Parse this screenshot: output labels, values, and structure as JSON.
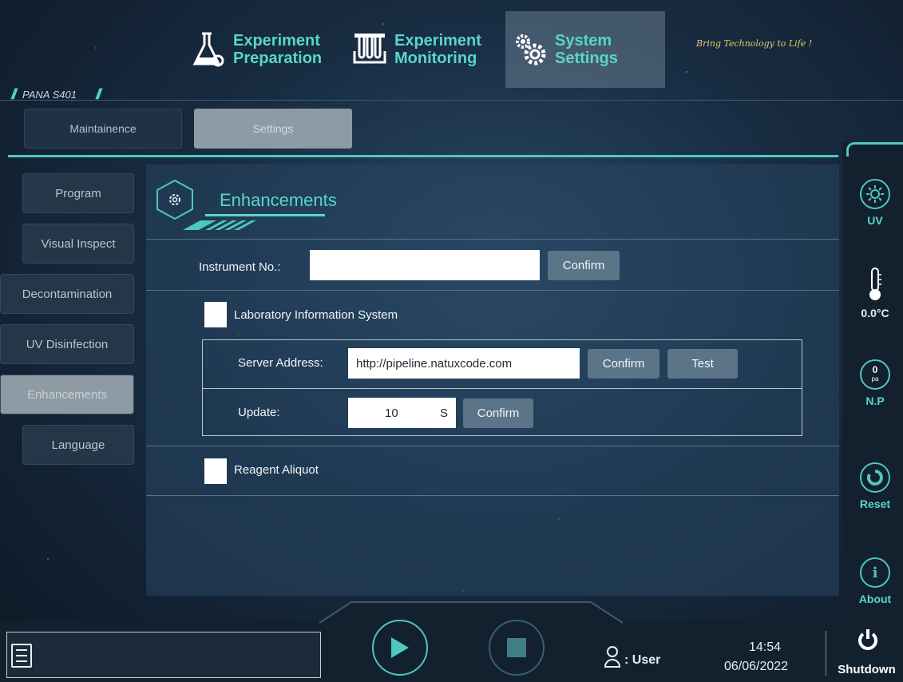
{
  "brand": {
    "model": "PANA S401",
    "tagline": "Bring Technology to Life !"
  },
  "nav": {
    "tabs": [
      {
        "line1": "Experiment",
        "line2": "Preparation",
        "icon": "flask-gear-icon"
      },
      {
        "line1": "Experiment",
        "line2": "Monitoring",
        "icon": "test-tube-rack-icon"
      },
      {
        "line1": "System",
        "line2": "Settings",
        "icon": "gears-icon",
        "active": true
      }
    ]
  },
  "subtabs": {
    "maintenance": "Maintainence",
    "settings": "Settings"
  },
  "left_menu": [
    "Program",
    "Visual Inspect",
    "Decontamination",
    "UV Disinfection",
    "Enhancements",
    "Language"
  ],
  "panel": {
    "title": "Enhancements",
    "instrument": {
      "label": "Instrument No.:",
      "value": "",
      "confirm": "Confirm"
    },
    "lis": {
      "label": "Laboratory Information System",
      "checked": false,
      "server_label": "Server Address:",
      "server_value": "http://pipeline.natuxcode.com",
      "server_confirm": "Confirm",
      "server_test": "Test",
      "update_label": "Update:",
      "update_value": "10",
      "update_unit": "S",
      "update_confirm": "Confirm"
    },
    "reagent": {
      "label": "Reagent Aliquot",
      "checked": false
    }
  },
  "rail": {
    "uv": "UV",
    "temperature": "0.0°C",
    "pressure_value": "0",
    "pressure_unit": "pa",
    "np": "N.P",
    "reset": "Reset",
    "about": "About",
    "about_glyph": "i"
  },
  "bottom": {
    "user_label": ": User",
    "time": "14:54",
    "date": "06/06/2022",
    "shutdown": "Shutdown"
  },
  "colors": {
    "accent": "#4fc8bd",
    "accent_text": "#58d6c9",
    "tagline": "#e8c86a"
  }
}
